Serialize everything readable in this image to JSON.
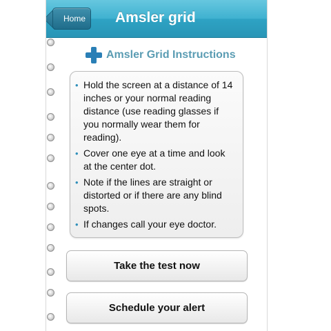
{
  "navbar": {
    "back_label": "Home",
    "title": "Amsler grid"
  },
  "section": {
    "icon": "medical-cross-icon",
    "title": "Amsler Grid Instructions"
  },
  "instructions": [
    "Hold the screen at a distance of 14 inches or your normal reading distance (use reading glasses if you normally wear them for reading).",
    "Cover one eye at a time and look at the center dot.",
    "Note if the lines are straight or distorted or if there are any blind spots.",
    "If changes call your eye doctor."
  ],
  "buttons": {
    "take_test": "Take the test now",
    "schedule_alert": "Schedule your alert"
  },
  "colors": {
    "navbar": "#3fb1d0",
    "accent": "#2a7fb6",
    "section_title": "#5a9cb3"
  }
}
